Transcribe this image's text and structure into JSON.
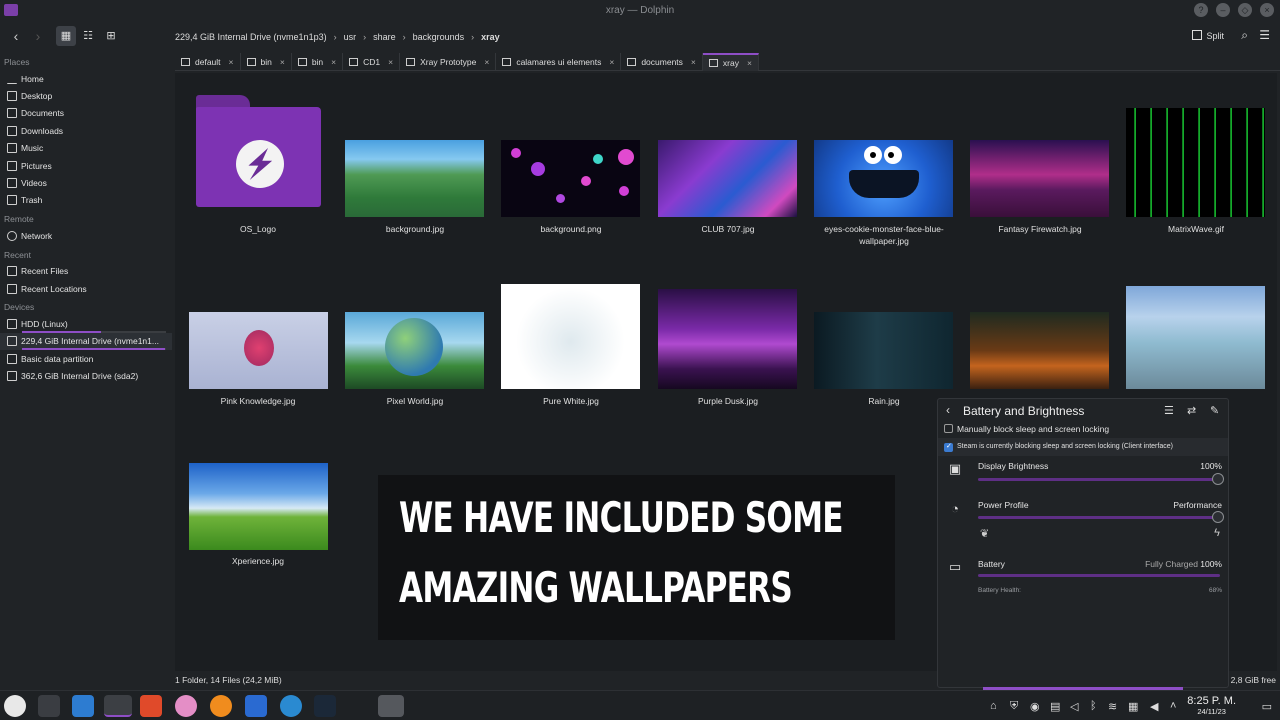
{
  "window": {
    "title": "xray — Dolphin"
  },
  "toolbar": {
    "crumbs": [
      "229,4 GiB Internal Drive (nvme1n1p3)",
      "usr",
      "share",
      "backgrounds",
      "xray"
    ],
    "split_label": "Split"
  },
  "sidebar": {
    "places_label": "Places",
    "places": [
      "Home",
      "Desktop",
      "Documents",
      "Downloads",
      "Music",
      "Pictures",
      "Videos",
      "Trash"
    ],
    "remote_label": "Remote",
    "remote": [
      "Network"
    ],
    "recent_label": "Recent",
    "recent": [
      "Recent Files",
      "Recent Locations"
    ],
    "devices_label": "Devices",
    "devices": [
      "HDD (Linux)",
      "229,4 GiB Internal Drive (nvme1n1...",
      "Basic data partition",
      "362,6 GiB Internal Drive (sda2)"
    ]
  },
  "tabs": [
    "default",
    "bin",
    "bin",
    "CD1",
    "Xray Prototype",
    "calamares ui elements",
    "documents",
    "xray"
  ],
  "files": [
    "OS_Logo",
    "background.jpg",
    "background.png",
    "CLUB 707.jpg",
    "eyes-cookie-monster-face-blue-wallpaper.jpg",
    "Fantasy Firewatch.jpg",
    "MatrixWave.gif",
    "Pink Knowledge.jpg",
    "Pixel World.jpg",
    "Pure White.jpg",
    "Purple Dusk.jpg",
    "Rain.jpg",
    "Xperience.jpg"
  ],
  "overlay": {
    "line1": "WE HAVE INCLUDED SOME",
    "line2": "AMAZING WALLPAPERS"
  },
  "status": {
    "summary": "1 Folder, 14 Files (24,2 MiB)",
    "free": "2,8 GiB free"
  },
  "battery_panel": {
    "title": "Battery and Brightness",
    "block_sleep": "Manually block sleep and screen locking",
    "steam_block": "Steam is currently blocking sleep and screen locking (Client interface)",
    "brightness_label": "Display Brightness",
    "brightness_value": "100%",
    "brightness_level": 1.0,
    "profile_label": "Power Profile",
    "profile_value": "Performance",
    "battery_label": "Battery",
    "battery_status": "Fully Charged",
    "battery_value": "100%",
    "battery_level": 1.0,
    "health_label": "Battery Health:",
    "health_value": "68%"
  },
  "clock": {
    "time": "8:25 P. M.",
    "date": "24/11/23"
  },
  "colors": {
    "accent": "#8e4ec6",
    "background": "#202326",
    "folder": "#7d33b3"
  }
}
